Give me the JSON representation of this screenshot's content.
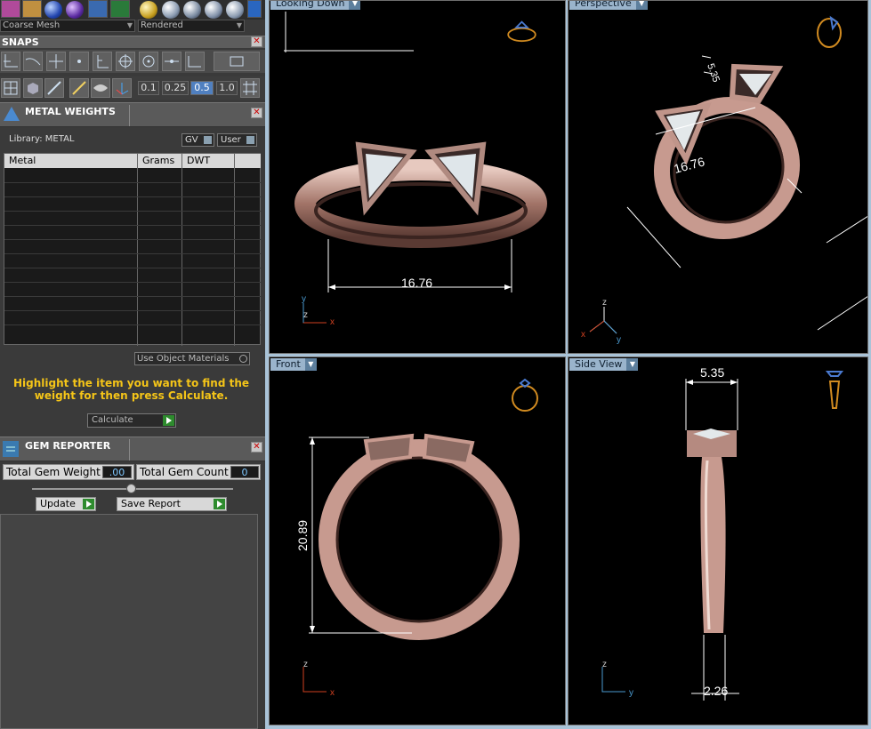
{
  "toolbar": {
    "mesh_select": "Coarse Mesh",
    "render_select": "Rendered"
  },
  "snaps": {
    "title": "SNAPS",
    "increments": [
      "0.1",
      "0.25",
      "0.5",
      "1.0"
    ],
    "active_increment": "0.5"
  },
  "metal_weights": {
    "title": "METAL WEIGHTS",
    "library_label": "Library: METAL",
    "gv_label": "GV",
    "user_label": "User",
    "columns": [
      "Metal",
      "Grams",
      "DWT"
    ],
    "use_object_materials": "Use Object Materials",
    "hint": "Highlight the item you want to find the weight for then press Calculate.",
    "calculate_label": "Calculate"
  },
  "gem_reporter": {
    "title": "GEM REPORTER",
    "total_weight_label": "Total Gem Weight",
    "total_weight_value": ".00",
    "total_count_label": "Total Gem Count",
    "total_count_value": "0",
    "update_label": "Update",
    "save_report_label": "Save Report"
  },
  "viewports": {
    "top_left": {
      "label": "Looking Down",
      "dimension": "16.76"
    },
    "top_right": {
      "label": "Perspective",
      "dimension_a": "16.76",
      "dimension_b": "5.35"
    },
    "bottom_left": {
      "label": "Front",
      "dimension": "20.89"
    },
    "bottom_right": {
      "label": "Side View",
      "dimension_top": "5.35",
      "dimension_bottom": "2.26"
    }
  },
  "colors": {
    "viewport_label_bg": "#9ab4cc",
    "ring_metal": "#c79a8f",
    "hint_text": "#f5c518",
    "accent_play": "#2e8b2e"
  }
}
